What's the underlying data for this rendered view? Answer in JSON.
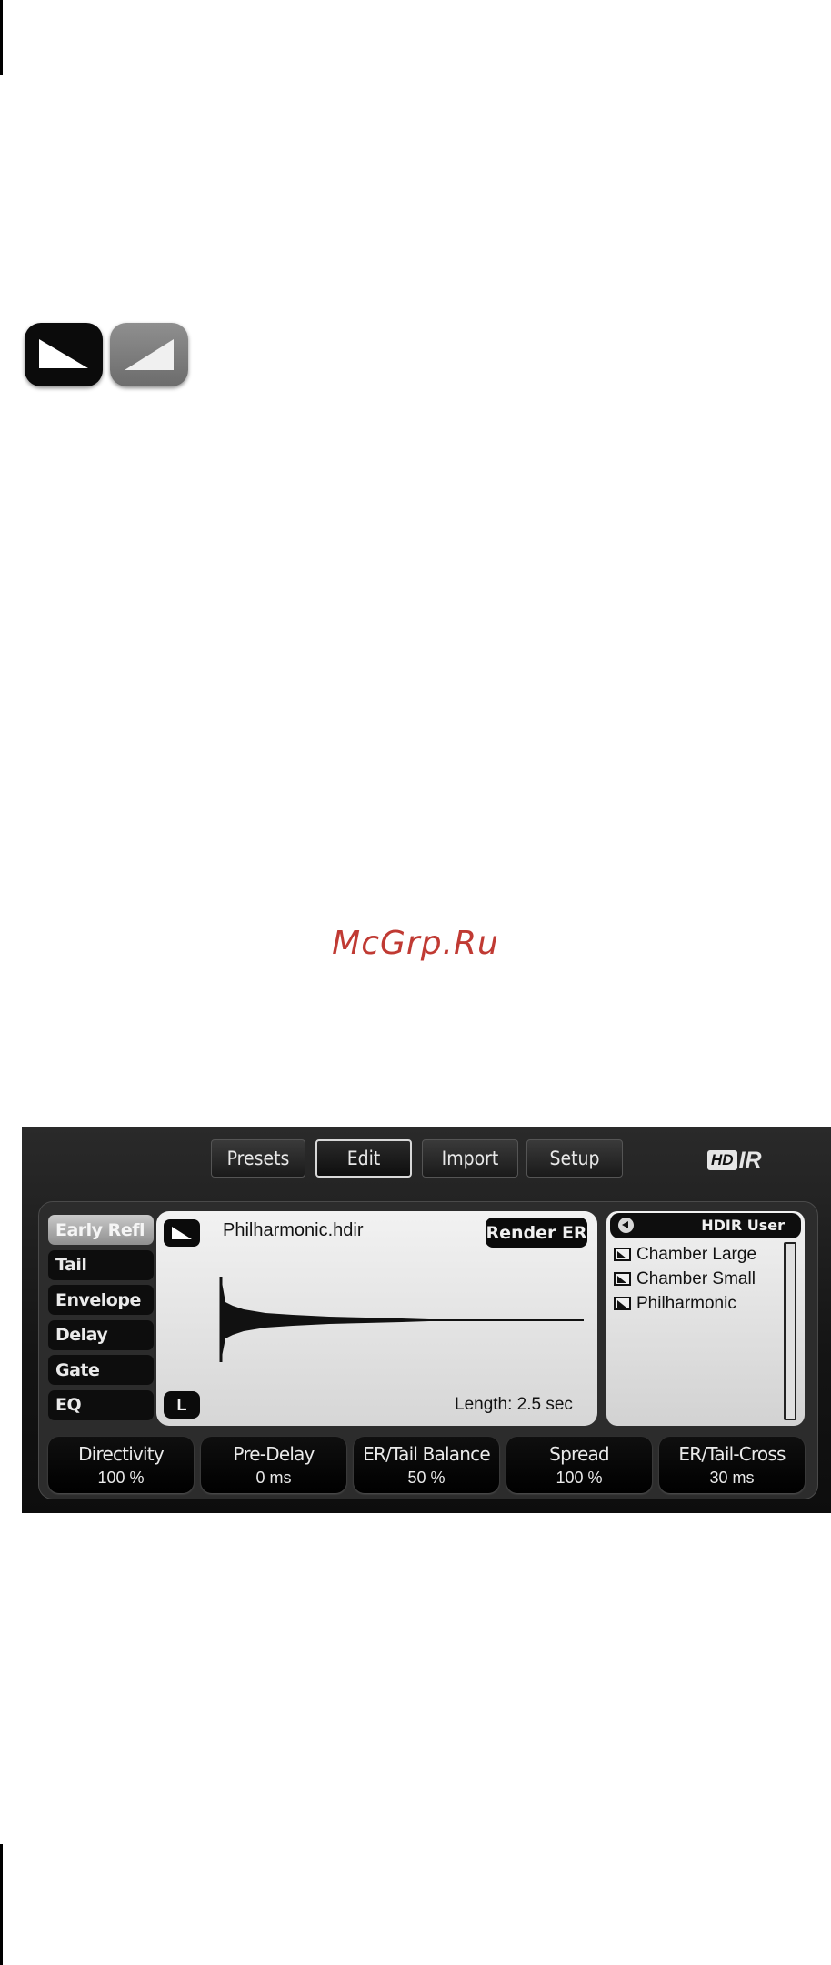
{
  "watermark": "McGrp.Ru",
  "mode_icons": [
    {
      "name": "mode-dark-icon"
    },
    {
      "name": "mode-grey-icon"
    }
  ],
  "plugin": {
    "top_tabs": [
      {
        "label": "Presets",
        "active": false
      },
      {
        "label": "Edit",
        "active": true
      },
      {
        "label": "Import",
        "active": false
      },
      {
        "label": "Setup",
        "active": false
      }
    ],
    "logo": {
      "box": "HD",
      "text": "IR"
    },
    "side_tabs": [
      {
        "label": "Early Refl",
        "active": true
      },
      {
        "label": "Tail",
        "active": false
      },
      {
        "label": "Envelope",
        "active": false
      },
      {
        "label": "Delay",
        "active": false
      },
      {
        "label": "Gate",
        "active": false
      },
      {
        "label": "EQ",
        "active": false
      }
    ],
    "waveform": {
      "filename": "Philharmonic.hdir",
      "render_label": "Render ER",
      "channel": "L",
      "length_label": "Length: 2.5 sec"
    },
    "browser": {
      "path": "HDIR User",
      "items": [
        "Chamber Large",
        "Chamber Small",
        "Philharmonic"
      ]
    },
    "params": [
      {
        "name": "Directivity",
        "value": "100 %"
      },
      {
        "name": "Pre-Delay",
        "value": "0 ms"
      },
      {
        "name": "ER/Tail Balance",
        "value": "50 %"
      },
      {
        "name": "Spread",
        "value": "100 %"
      },
      {
        "name": "ER/Tail-Cross",
        "value": "30 ms"
      }
    ]
  }
}
